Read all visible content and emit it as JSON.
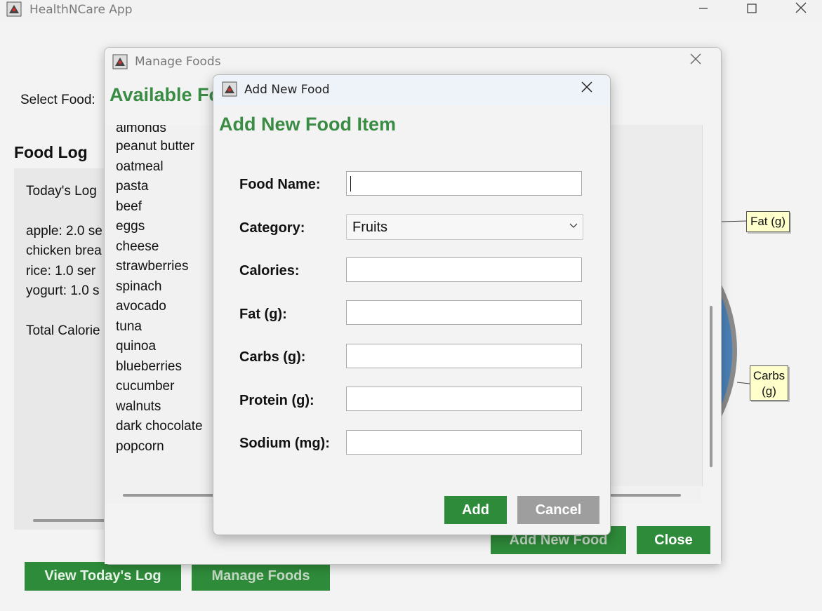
{
  "main_window": {
    "title": "HealthNCare App",
    "select_food_label": "Select Food:",
    "food_log_heading": "Food Log",
    "log_lines": [
      "Today's Log",
      "",
      "apple: 2.0 se",
      "chicken brea",
      "rice: 1.0 ser",
      "yogurt: 1.0 s",
      "",
      "Total Calorie"
    ],
    "buttons": {
      "view_log": "View Today's Log",
      "manage_foods": "Manage Foods"
    },
    "chart_callouts": {
      "fat": "Fat (g)",
      "carbs": "Carbs (g)"
    }
  },
  "manage_dialog": {
    "title": "Manage Foods",
    "heading": "Available Fo",
    "foods": [
      "almonds",
      "peanut butter",
      "oatmeal",
      "pasta",
      "beef",
      "eggs",
      "cheese",
      "strawberries",
      "spinach",
      "avocado",
      "tuna",
      "quinoa",
      "blueberries",
      "cucumber",
      "walnuts",
      "dark chocolate",
      "popcorn"
    ],
    "buttons": {
      "add_new_food": "Add New Food",
      "close": "Close"
    }
  },
  "add_dialog": {
    "title": "Add New Food",
    "heading": "Add New Food Item",
    "fields": {
      "food_name": {
        "label": "Food Name:",
        "value": ""
      },
      "category": {
        "label": "Category:",
        "value": "Fruits"
      },
      "calories": {
        "label": "Calories:",
        "value": ""
      },
      "fat": {
        "label": "Fat (g):",
        "value": ""
      },
      "carbs": {
        "label": "Carbs (g):",
        "value": ""
      },
      "protein": {
        "label": "Protein (g):",
        "value": ""
      },
      "sodium": {
        "label": "Sodium (mg):",
        "value": ""
      }
    },
    "buttons": {
      "add": "Add",
      "cancel": "Cancel"
    }
  },
  "colors": {
    "accent_green": "#2e8b3a",
    "heading_green": "#3a8c44",
    "cancel_gray": "#9e9e9e",
    "callout_yellow": "#ffffcc",
    "pie_blue": "#4a7fb5"
  },
  "icons": [
    "app-icon",
    "minimize-icon",
    "maximize-icon",
    "close-icon",
    "chevron-down-icon"
  ]
}
